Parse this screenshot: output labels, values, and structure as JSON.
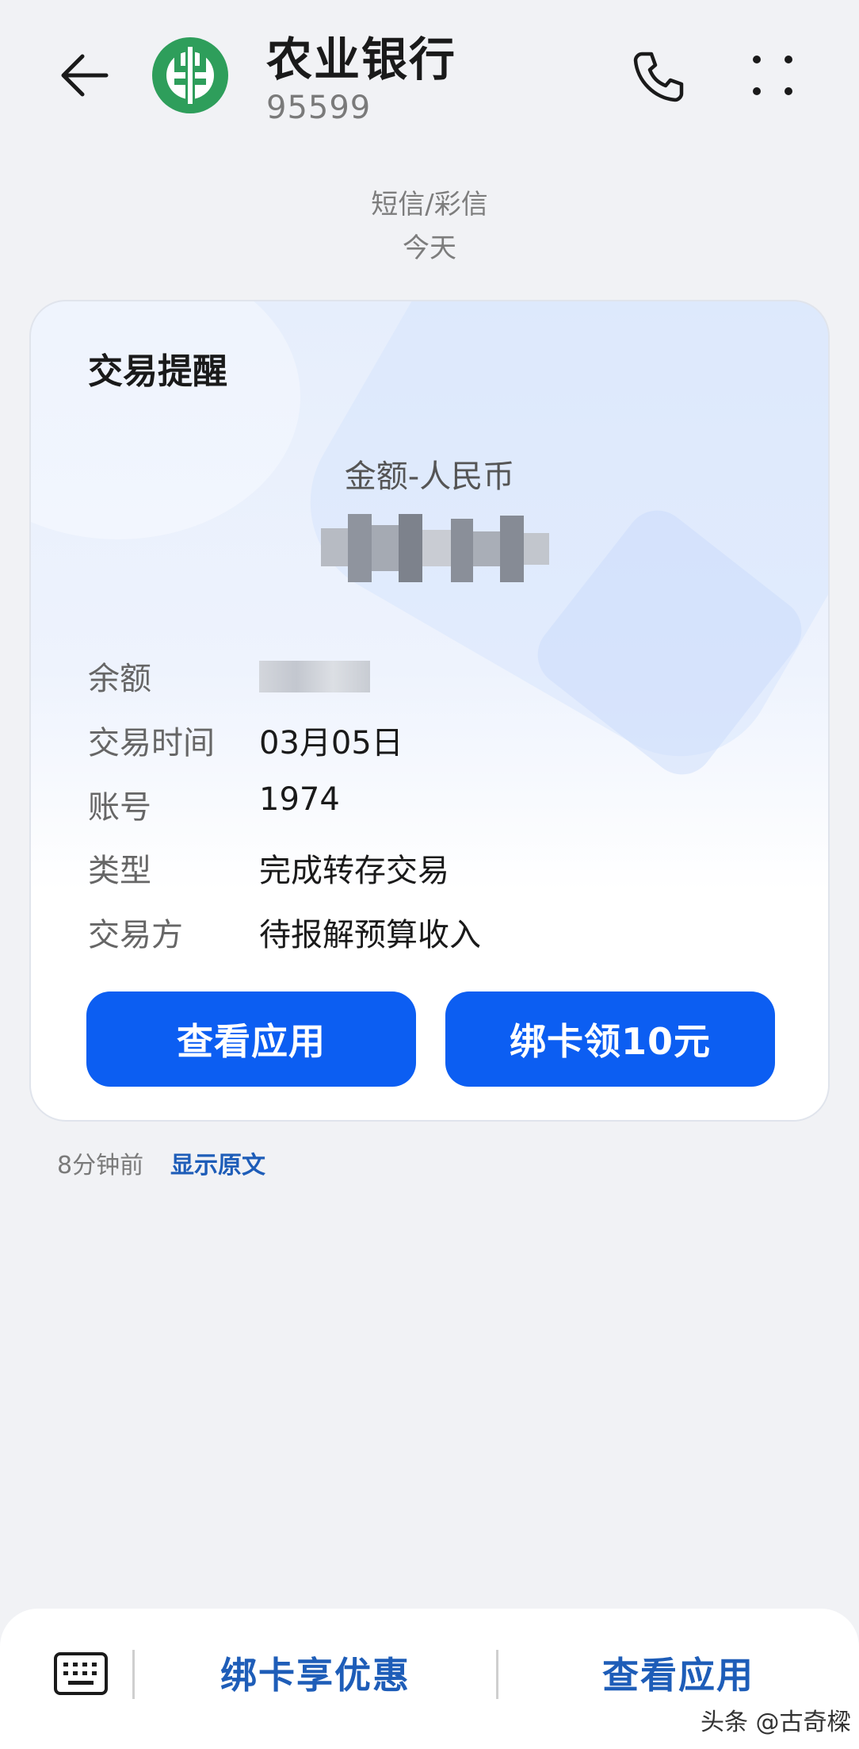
{
  "header": {
    "title": "农业银行",
    "number": "95599"
  },
  "meta": {
    "channel": "短信/彩信",
    "date": "今天"
  },
  "card": {
    "title": "交易提醒",
    "amount_label": "金额-人民币",
    "rows": [
      {
        "key": "余额",
        "value": ""
      },
      {
        "key": "交易时间",
        "value": "03月05日"
      },
      {
        "key": "账号",
        "value": "1974"
      },
      {
        "key": "类型",
        "value": "完成转存交易"
      },
      {
        "key": "交易方",
        "value": "待报解预算收入"
      }
    ],
    "buttons": {
      "view_app": "查看应用",
      "bind_card": "绑卡领10元"
    }
  },
  "message_footer": {
    "time": "8分钟前",
    "show_original": "显示原文"
  },
  "bottom_bar": {
    "link1": "绑卡享优惠",
    "link2": "查看应用"
  },
  "watermark": "头条 @古奇樑",
  "colors": {
    "accent": "#0c5ef2",
    "link": "#1e5db8",
    "logo_green": "#2e9e5b",
    "background": "#f1f2f5"
  },
  "icons": [
    "back-arrow-icon",
    "abc-logo-icon",
    "phone-icon",
    "more-dots-icon",
    "keyboard-icon"
  ]
}
